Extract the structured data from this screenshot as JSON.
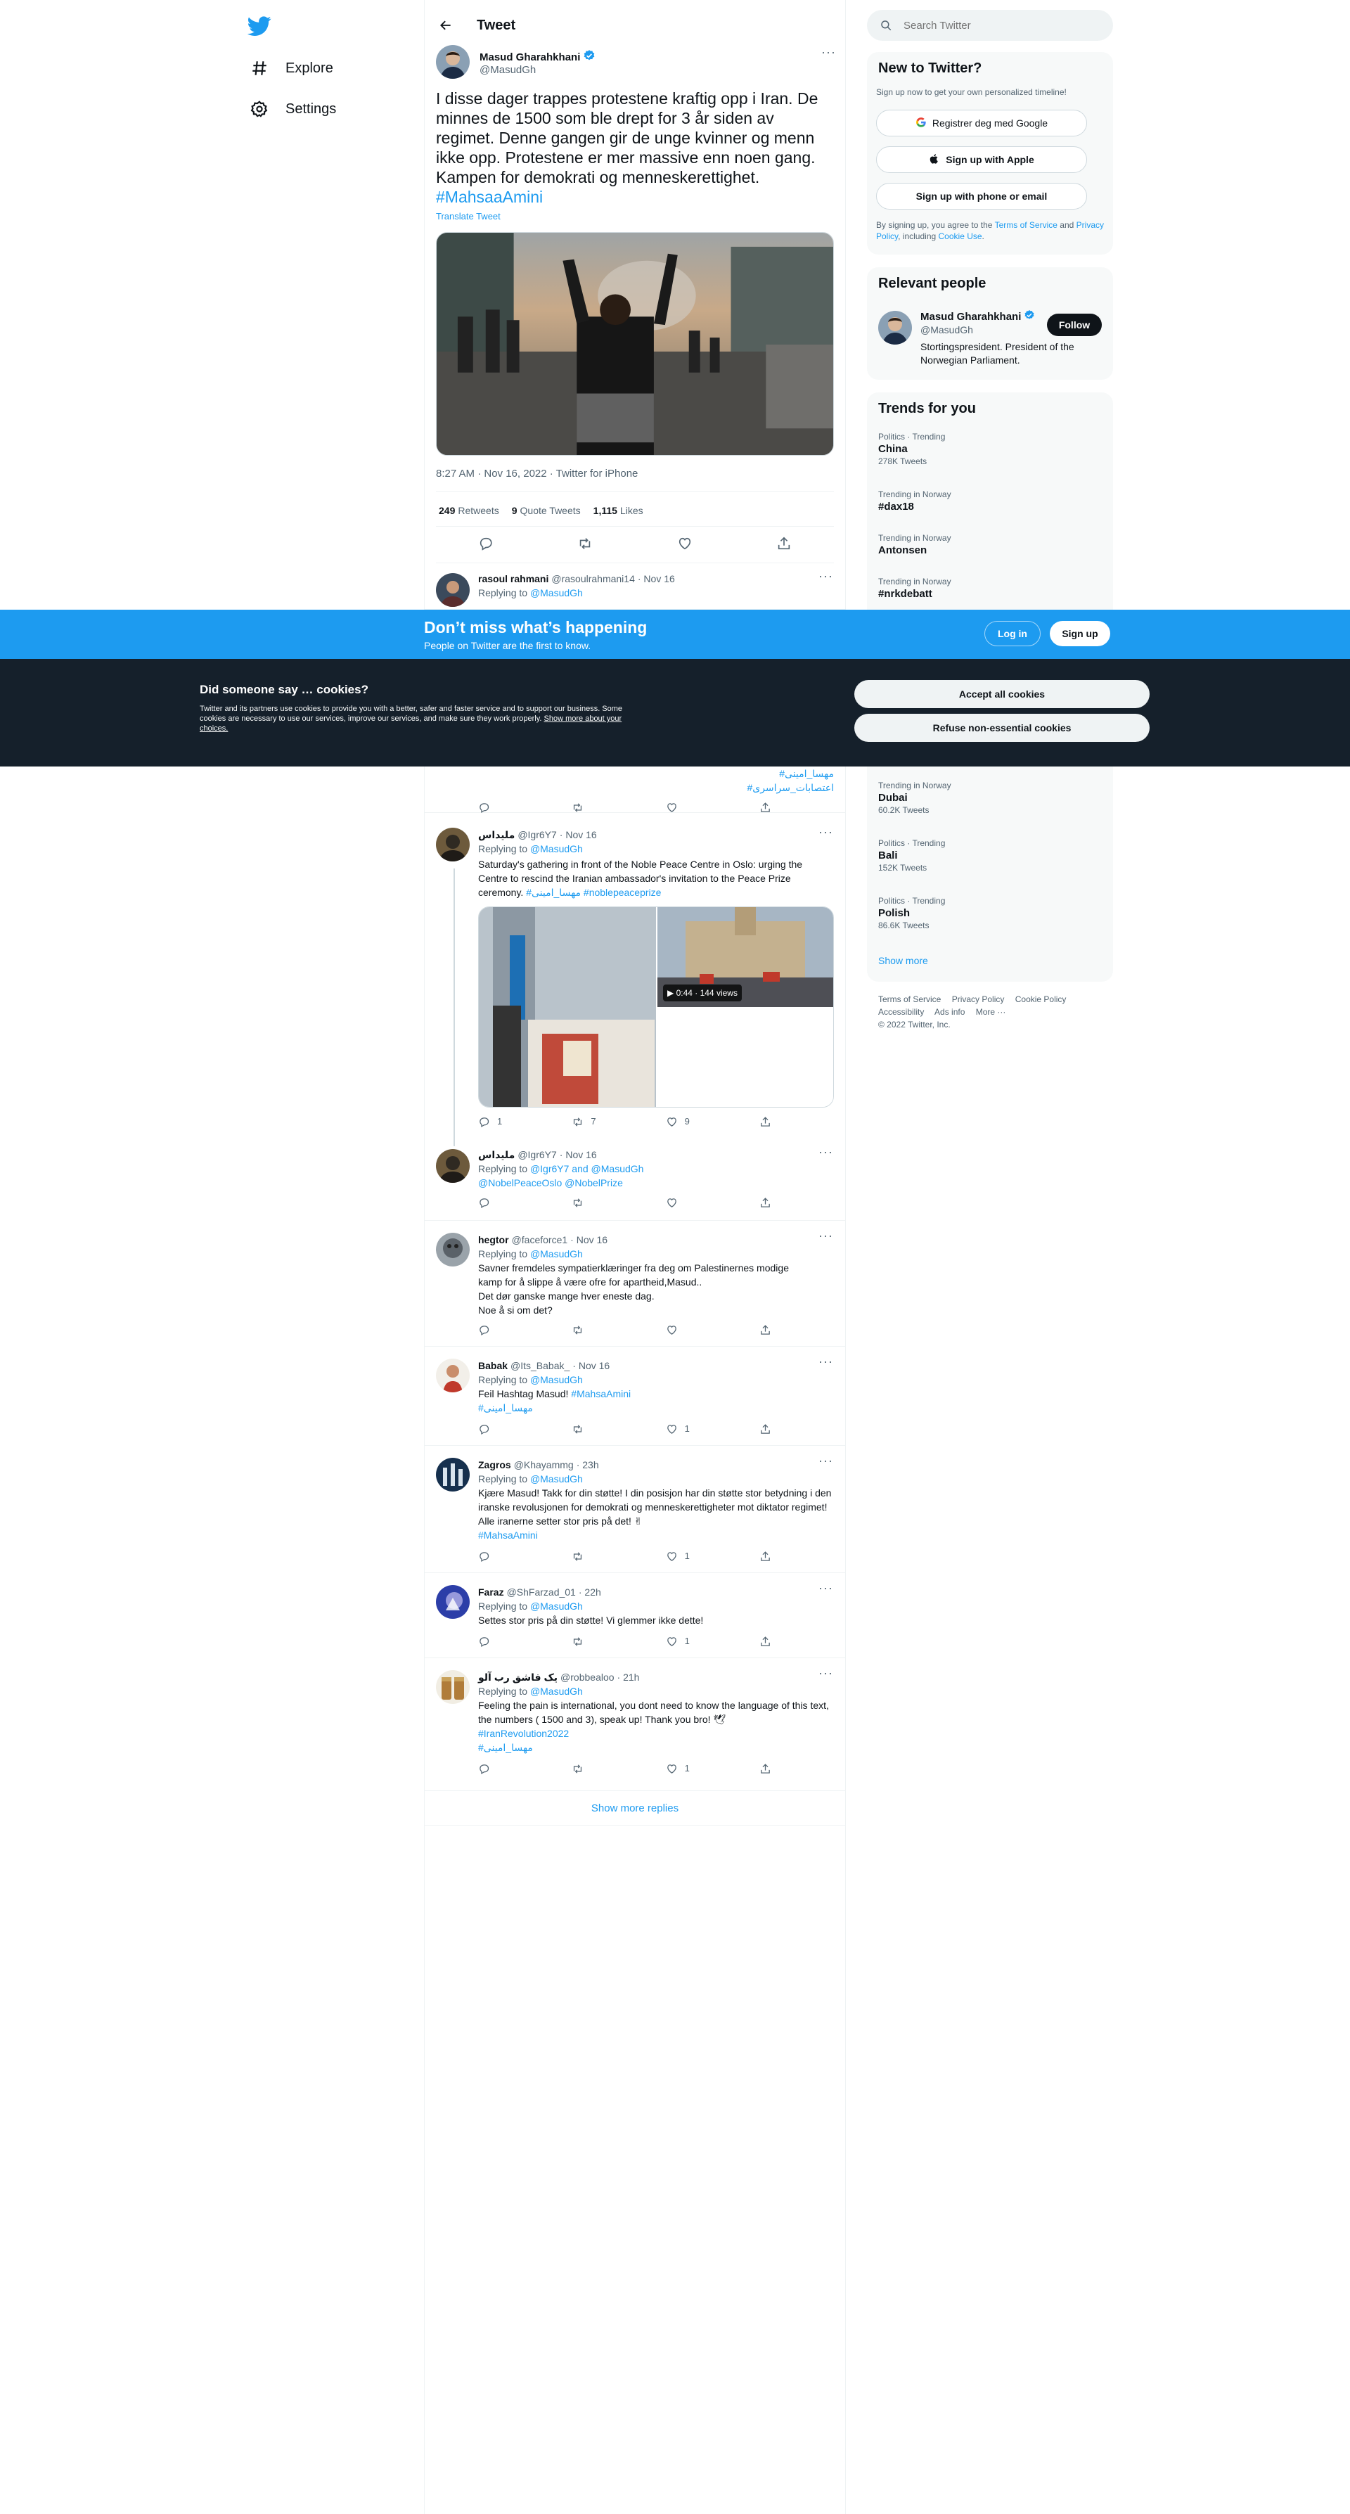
{
  "nav": {
    "explore": "Explore",
    "settings": "Settings"
  },
  "header": {
    "title": "Tweet"
  },
  "main_tweet": {
    "name": "Masud Gharahkhani",
    "handle": "@MasudGh",
    "text": "I disse dager trappes protestene kraftig opp i Iran. De minnes de 1500 som ble drept for 3 år siden av regimet. Denne gangen gir de unge kvinner og menn ikke opp. Protestene er mer massive enn noen gang. Kampen for demokrati og menneskerettighet.",
    "hashtag": "#MahsaaAmini",
    "translate": "Translate Tweet",
    "meta": "8:27 AM · Nov 16, 2022 · Twitter for iPhone",
    "retweets": "249",
    "retweets_label": "Retweets",
    "quotes": "9",
    "quotes_label": "Quote Tweets",
    "likes": "1,115",
    "likes_label": "Likes"
  },
  "replies": [
    {
      "name": "rasoul rahmani",
      "handle": "@rasoulrahmani14",
      "time": "· Nov 16",
      "replying": "Replying to",
      "to": "@MasudGh"
    },
    {
      "tags_a": "#مهسا_امینی",
      "tags_b": "#اعتصابات_سراسری"
    },
    {
      "name": "مليداس",
      "handle": "@Igr6Y7",
      "time": "· Nov 16",
      "replying": "Replying to",
      "to": "@MasudGh",
      "text": "Saturday's gathering in front of the Noble Peace Centre in Oslo: urging the Centre to rescind the Iranian ambassador's invitation to the Peace Prize ceremony.",
      "tags": "#مهسا_امینی #noblepeaceprize",
      "video": "0:44 · 144 views",
      "c_reply": "1",
      "c_rt": "7",
      "c_like": "9"
    },
    {
      "name": "مليداس",
      "handle": "@Igr6Y7",
      "time": "· Nov 16",
      "replying": "Replying to",
      "to": "@Igr6Y7 and @MasudGh",
      "text": "@NobelPeaceOslo @NobelPrize"
    },
    {
      "name": "hegtor",
      "handle": "@faceforce1",
      "time": "· Nov 16",
      "replying": "Replying to",
      "to": "@MasudGh",
      "l1": "Savner fremdeles sympatierklæringer fra deg om Palestinernes modige",
      "l2": "kamp for å slippe å være ofre for apartheid,Masud..",
      "l3": "Det dør ganske mange hver eneste dag.",
      "l4": "Noe å si om det?"
    },
    {
      "name": "Babak",
      "handle": "@Its_Babak_",
      "time": "· Nov 16",
      "replying": "Replying to",
      "to": "@MasudGh",
      "text": "Feil Hashtag Masud!",
      "tag1": "#MahsaAmini",
      "tag2": "#مهسا_امینی",
      "c_like": "1"
    },
    {
      "name": "Zagros",
      "handle": "@Khayammg",
      "time": "· 23h",
      "replying": "Replying to",
      "to": "@MasudGh",
      "text": "Kjære Masud! Takk for din støtte! I din posisjon har din støtte stor betydning i den iranske revolusjonen for demokrati og menneskerettigheter mot diktator regimet! Alle iranerne setter stor pris på det! ✌",
      "tag": "#MahsaAmini",
      "c_like": "1"
    },
    {
      "name": "Faraz",
      "handle": "@ShFarzad_01",
      "time": "· 22h",
      "replying": "Replying to",
      "to": "@MasudGh",
      "text": "Settes stor pris på din støtte! Vi glemmer ikke dette!",
      "c_like": "1"
    },
    {
      "name": "یک فاشق رب آلو",
      "handle": "@robbealoo",
      "time": "· 21h",
      "replying": "Replying to",
      "to": "@MasudGh",
      "text": "Feeling the pain is international, you dont need to know the language of this text, the numbers ( 1500 and 3), speak up! Thank you bro! 🕊",
      "tag1": "#IranRevolution2022",
      "tag2": "#مهسا_امینی",
      "c_like": "1"
    }
  ],
  "show_more_replies": "Show more replies",
  "search": {
    "placeholder": "Search Twitter"
  },
  "new_to_twitter": {
    "title": "New to Twitter?",
    "sub": "Sign up now to get your own personalized timeline!",
    "google": "Registrer deg med Google",
    "apple": "Sign up with Apple",
    "phone": "Sign up with phone or email",
    "legal_a": "By signing up, you agree to the",
    "tos": "Terms of Service",
    "legal_b": "and",
    "privacy": "Privacy Policy",
    "legal_c": ", including",
    "cookie": "Cookie Use",
    "legal_d": "."
  },
  "relevant": {
    "title": "Relevant people",
    "name": "Masud Gharahkhani",
    "handle": "@MasudGh",
    "follow": "Follow",
    "bio": "Stortingspresident. President of the Norwegian Parliament."
  },
  "trends": {
    "title": "Trends for you",
    "items": [
      {
        "cat": "Politics · Trending",
        "name": "China",
        "count": "278K Tweets"
      },
      {
        "cat": "Trending in Norway",
        "name": "#dax18",
        "count": ""
      },
      {
        "cat": "Trending in Norway",
        "name": "Antonsen",
        "count": ""
      },
      {
        "cat": "Trending in Norway",
        "name": "#nrkdebatt",
        "count": ""
      },
      {
        "cat": "Trending in Norway",
        "name": "Dubai",
        "count": "60.2K Tweets"
      },
      {
        "cat": "Politics · Trending",
        "name": "Bali",
        "count": "152K Tweets"
      },
      {
        "cat": "Politics · Trending",
        "name": "Polish",
        "count": "86.6K Tweets"
      }
    ],
    "show_more": "Show more"
  },
  "footer": {
    "tos": "Terms of Service",
    "privacy": "Privacy Policy",
    "cookie": "Cookie Policy",
    "access": "Accessibility",
    "ads": "Ads info",
    "more": "More ···",
    "copy": "© 2022 Twitter, Inc."
  },
  "signup_bar": {
    "headline": "Don’t miss what’s happening",
    "sub": "People on Twitter are the first to know.",
    "login": "Log in",
    "signup": "Sign up"
  },
  "cookie": {
    "title": "Did someone say … cookies?",
    "body": "Twitter and its partners use cookies to provide you with a better, safer and faster service and to support our business. Some cookies are necessary to use our services, improve our services, and make sure they work properly.",
    "link": "Show more about your choices.",
    "accept": "Accept all cookies",
    "refuse": "Refuse non-essential cookies"
  },
  "colors": {
    "brand": "#1d9bf0",
    "text": "#0f1419",
    "muted": "#536471",
    "dark": "#15202b"
  }
}
